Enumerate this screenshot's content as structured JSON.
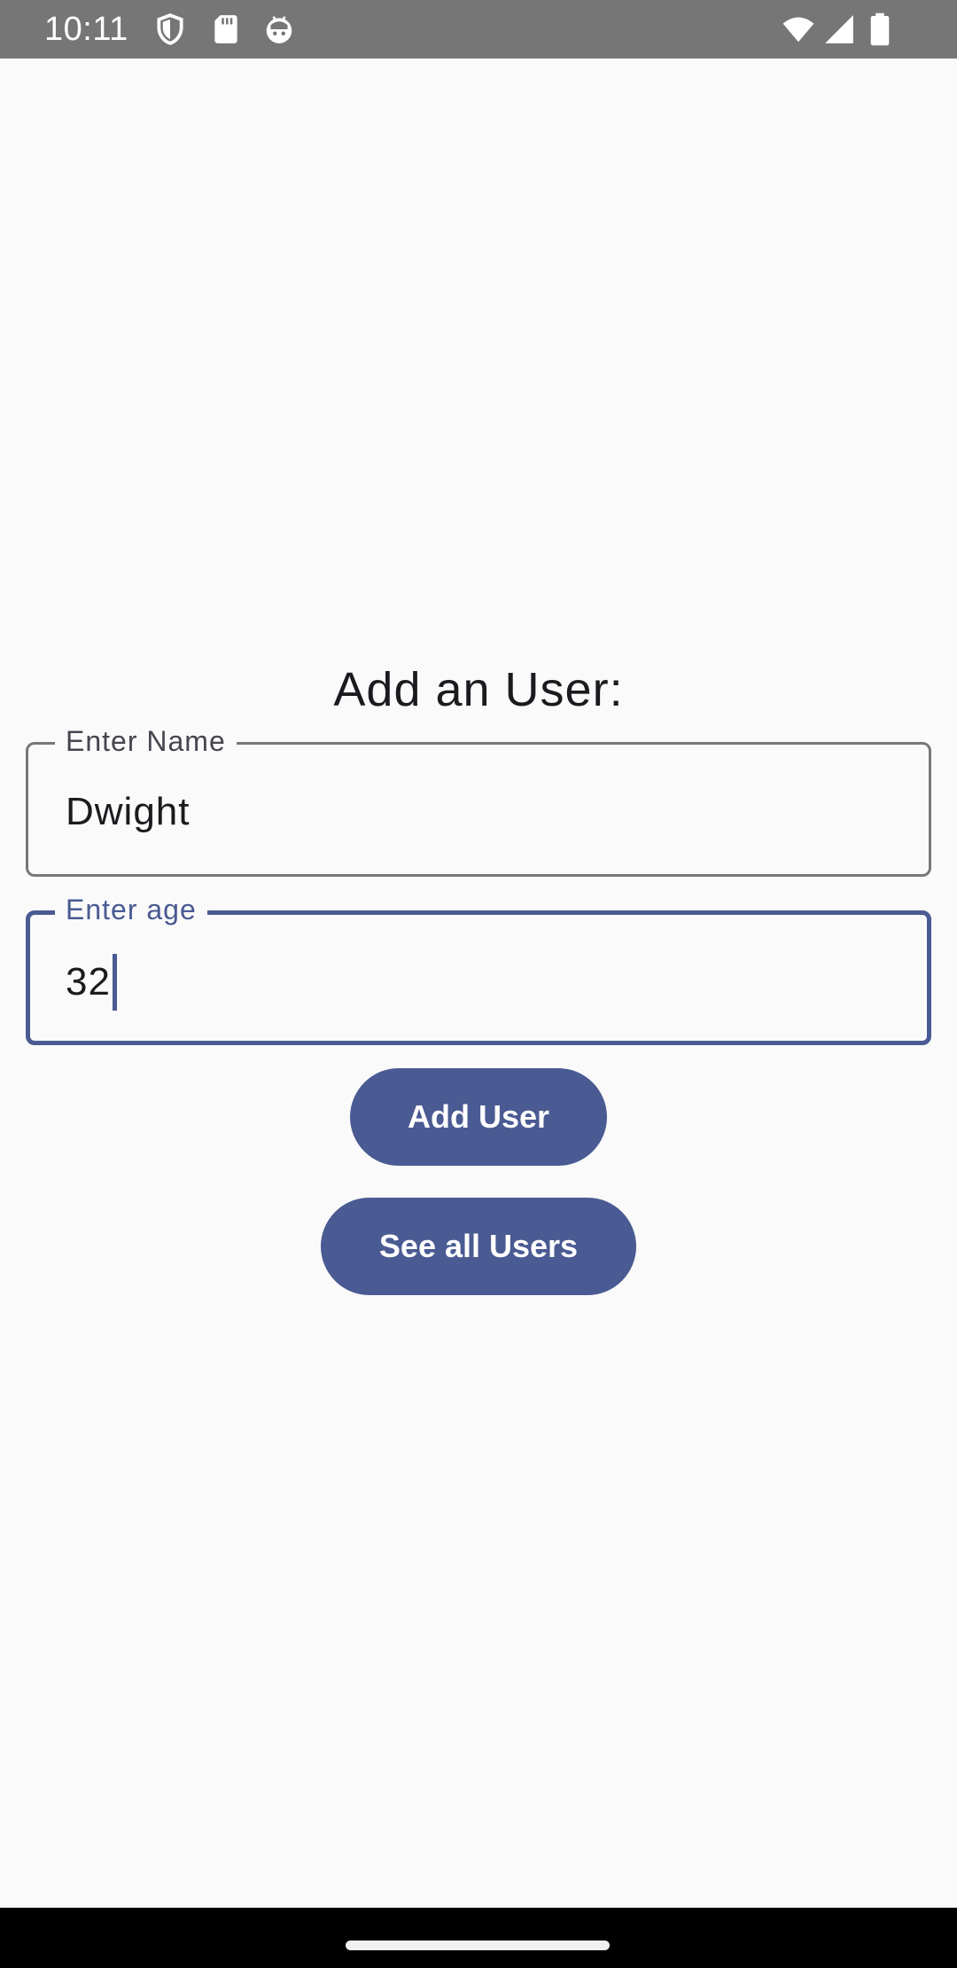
{
  "status_bar": {
    "time": "10:11",
    "left_icons": [
      "shield-icon",
      "sd-card-icon",
      "android-debug-icon"
    ],
    "right_icons": [
      "wifi-icon",
      "cellular-signal-icon",
      "battery-icon"
    ]
  },
  "form": {
    "title": "Add an User:",
    "name_field": {
      "label": "Enter Name",
      "value": "Dwight"
    },
    "age_field": {
      "label": "Enter age",
      "value": "32"
    }
  },
  "buttons": {
    "add_user": "Add User",
    "see_all_users": "See all Users"
  },
  "colors": {
    "primary": "#4a5a92",
    "background": "#fafafa",
    "status_bar": "#767676",
    "outline": "#77777c"
  }
}
